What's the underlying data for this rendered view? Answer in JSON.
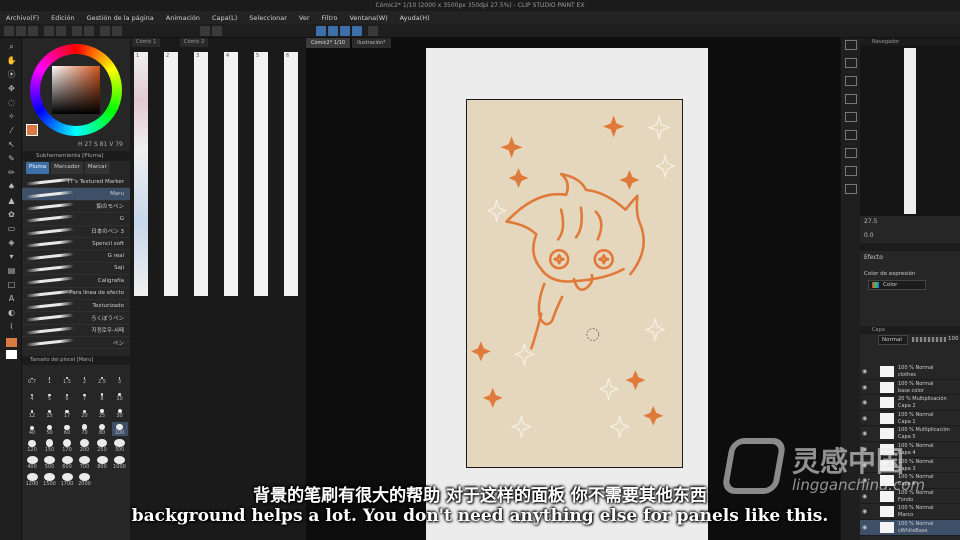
{
  "window": {
    "title": "Cómic2* 1/10 (2000 x 3500px 350dpi 27.5%) - CLIP STUDIO PAINT EX"
  },
  "menu": [
    "Archivo(F)",
    "Edición",
    "Gestión de la página",
    "Animación",
    "Capa(L)",
    "Seleccionar",
    "Ver",
    "Filtro",
    "Ventana(W)",
    "Ayuda(H)"
  ],
  "doc_tabs": [
    "Cómic2* 1/10",
    "Ilustración*"
  ],
  "page_tabs": [
    "Cómic 1",
    "Cómic 2"
  ],
  "color": {
    "current": "#d97a45",
    "hsv_readout": "H 27  S 81  V 79"
  },
  "subtool": {
    "header": "Subherramienta [Pluma]",
    "tabs": [
      "Pluma",
      "Marcador",
      "Marcar"
    ],
    "active_tab": "Pluma",
    "brushes": [
      "TT's Textured Marker",
      "Maru",
      "鉛のモペン",
      "G",
      "日本のペン 3",
      "Spencil soft",
      "G real",
      "Saji",
      "Caligrafía",
      "Para línea de efecto",
      "Texturizado",
      "ろくぼうペン",
      "지정로우-서페",
      "ペン"
    ],
    "selected": "Maru"
  },
  "brush_size": {
    "header": "Tamaño del pincel [Maru]",
    "sizes": [
      "0.7",
      "1",
      "1.5",
      "2",
      "2.5",
      "3",
      "4",
      "5",
      "6",
      "7",
      "8",
      "10",
      "12",
      "15",
      "17",
      "20",
      "25",
      "30",
      "40",
      "50",
      "60",
      "70",
      "80",
      "100",
      "120",
      "150",
      "170",
      "200",
      "250",
      "300",
      "400",
      "500",
      "600",
      "700",
      "800",
      "1000",
      "1200",
      "1500",
      "1700",
      "2000"
    ],
    "selected": "100"
  },
  "pages": [
    "1",
    "2",
    "3",
    "4",
    "5",
    "6"
  ],
  "navigator": {
    "header": "Navegador",
    "zoom": "27.5",
    "rotation": "0.0"
  },
  "effect": {
    "label": "Efecto",
    "expression_label": "Color de expresión",
    "expression_value": "Color"
  },
  "layer_panel": {
    "header": "Capa",
    "blend": "Normal",
    "opacity": "100"
  },
  "layers": [
    {
      "mode": "100 % Normal",
      "name": "clothes"
    },
    {
      "mode": "100 % Normal",
      "name": "base color"
    },
    {
      "mode": "20 % Multiplicación",
      "name": "Capa 2"
    },
    {
      "mode": "100 % Normal",
      "name": "Capa 1"
    },
    {
      "mode": "100 % Multiplicación",
      "name": "Capa 5"
    },
    {
      "mode": "100 % Normal",
      "name": "Capa 4"
    },
    {
      "mode": "100 % Normal",
      "name": "Capa 3"
    },
    {
      "mode": "100 % Normal",
      "name": "Capa 6"
    },
    {
      "mode": "100 % Normal",
      "name": "Fondo"
    },
    {
      "mode": "100 % Normal",
      "name": "Marco"
    },
    {
      "mode": "100 % Normal",
      "name": "cWhiteBase"
    }
  ],
  "selected_layer": "cWhiteBase",
  "subtitles": {
    "cn": "背景的笔刷有很大的帮助 对于这样的面板 你不需要其他东西",
    "en": "background helps a lot. You don't need anything else for panels  like this."
  },
  "watermark": {
    "cn": "灵感中国",
    "en": "lingganchina.com"
  }
}
